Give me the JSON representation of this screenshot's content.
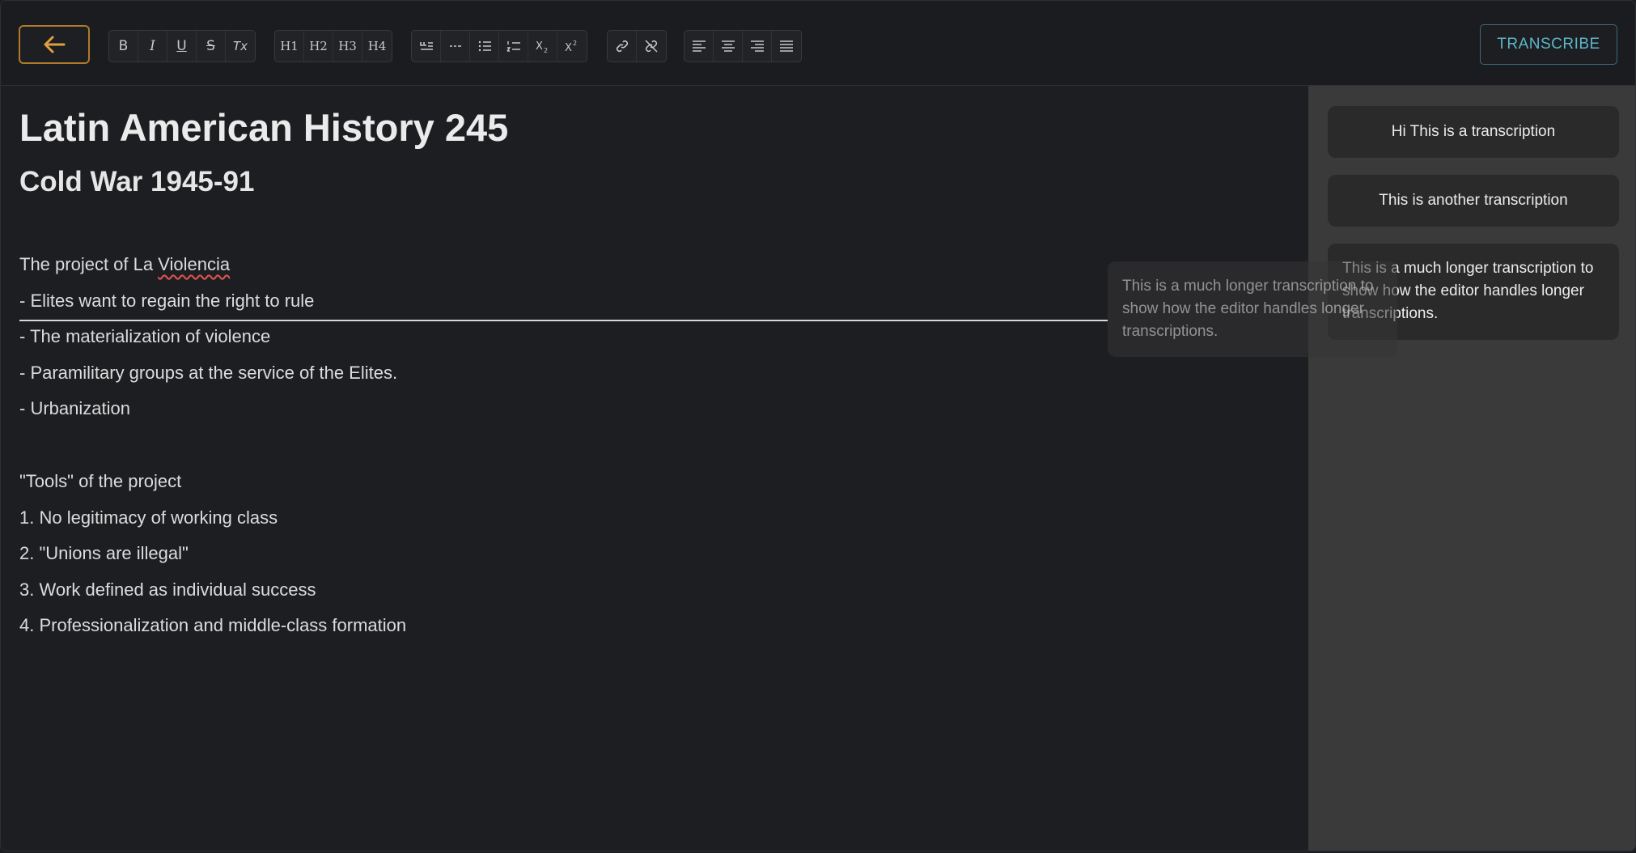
{
  "toolbar": {
    "back_icon": "arrow-left-icon",
    "text_format": [
      "B",
      "I",
      "U",
      "S",
      "Tx"
    ],
    "headings": [
      "H1",
      "H2",
      "H3",
      "H4"
    ],
    "blocks": [
      "quote-icon",
      "horizontal-rule-icon",
      "bullet-list-icon",
      "numbered-list-icon",
      "subscript-icon",
      "superscript-icon"
    ],
    "links": [
      "link-icon",
      "unlink-icon"
    ],
    "align": [
      "align-left-icon",
      "align-center-icon",
      "align-right-icon",
      "align-justify-icon"
    ],
    "transcribe_label": "TRANSCRIBE"
  },
  "editor": {
    "title": "Latin American History 245",
    "subtitle": "Cold War 1945-91",
    "intro_prefix": "The project of La ",
    "intro_misspelled": "Violencia",
    "lines_a": [
      "- Elites want to regain the right to rule",
      "- The materialization of violence",
      "- Paramilitary groups at the service of the Elites.",
      "- Urbanization"
    ],
    "tools_heading": "\"Tools\" of the project",
    "lines_b": [
      "1. No legitimacy of working class",
      "2. \"Unions are illegal\"",
      "3. Work defined as individual success",
      "4. Professionalization and middle-class formation"
    ]
  },
  "transcriptions": [
    "Hi This is a transcription",
    "This is another transcription",
    "This is a much longer transcription to show how the editor handles longer transcriptions."
  ],
  "drag_ghost": "This is a much longer transcription to show how the editor handles longer transcriptions.",
  "colors": {
    "accent_back": "#b07a2a",
    "accent_transcribe": "#5fb5c9",
    "background": "#1d1e21",
    "sidebar": "#3a3a3b"
  }
}
